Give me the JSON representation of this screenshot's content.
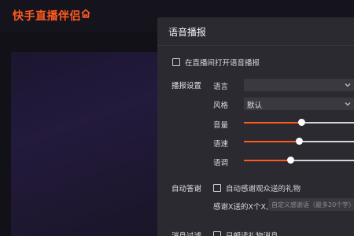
{
  "app": {
    "title": "快手直播伴侣"
  },
  "dialog": {
    "title": "语音播报",
    "enable_voice_broadcast": {
      "label": "在直播间打开语音播报",
      "checked": false
    },
    "broadcast_settings": {
      "section_label": "播报设置",
      "language": {
        "label": "语言",
        "value": ""
      },
      "style": {
        "label": "风格",
        "value": "默认"
      },
      "volume": {
        "label": "音量",
        "level": 0.52
      },
      "speed": {
        "label": "语速",
        "level": 0.5
      },
      "pitch": {
        "label": "语调",
        "level": 0.42
      }
    },
    "auto_reply": {
      "section_label": "自动答谢",
      "thank_gifts": {
        "label": "自动感谢观众送的礼物",
        "checked": false
      },
      "thanks_text_label": "感谢X送的X个X,",
      "thanks_placeholder": "自定义感谢语（最多20个字）"
    },
    "message_filter": {
      "section_label": "消息过滤",
      "gift_only": {
        "label": "只朗读礼物消息",
        "checked": false
      }
    }
  },
  "colors": {
    "accent": "#ff5a1f",
    "dialog_bg": "#2b2a31",
    "app_bg": "#121118"
  }
}
